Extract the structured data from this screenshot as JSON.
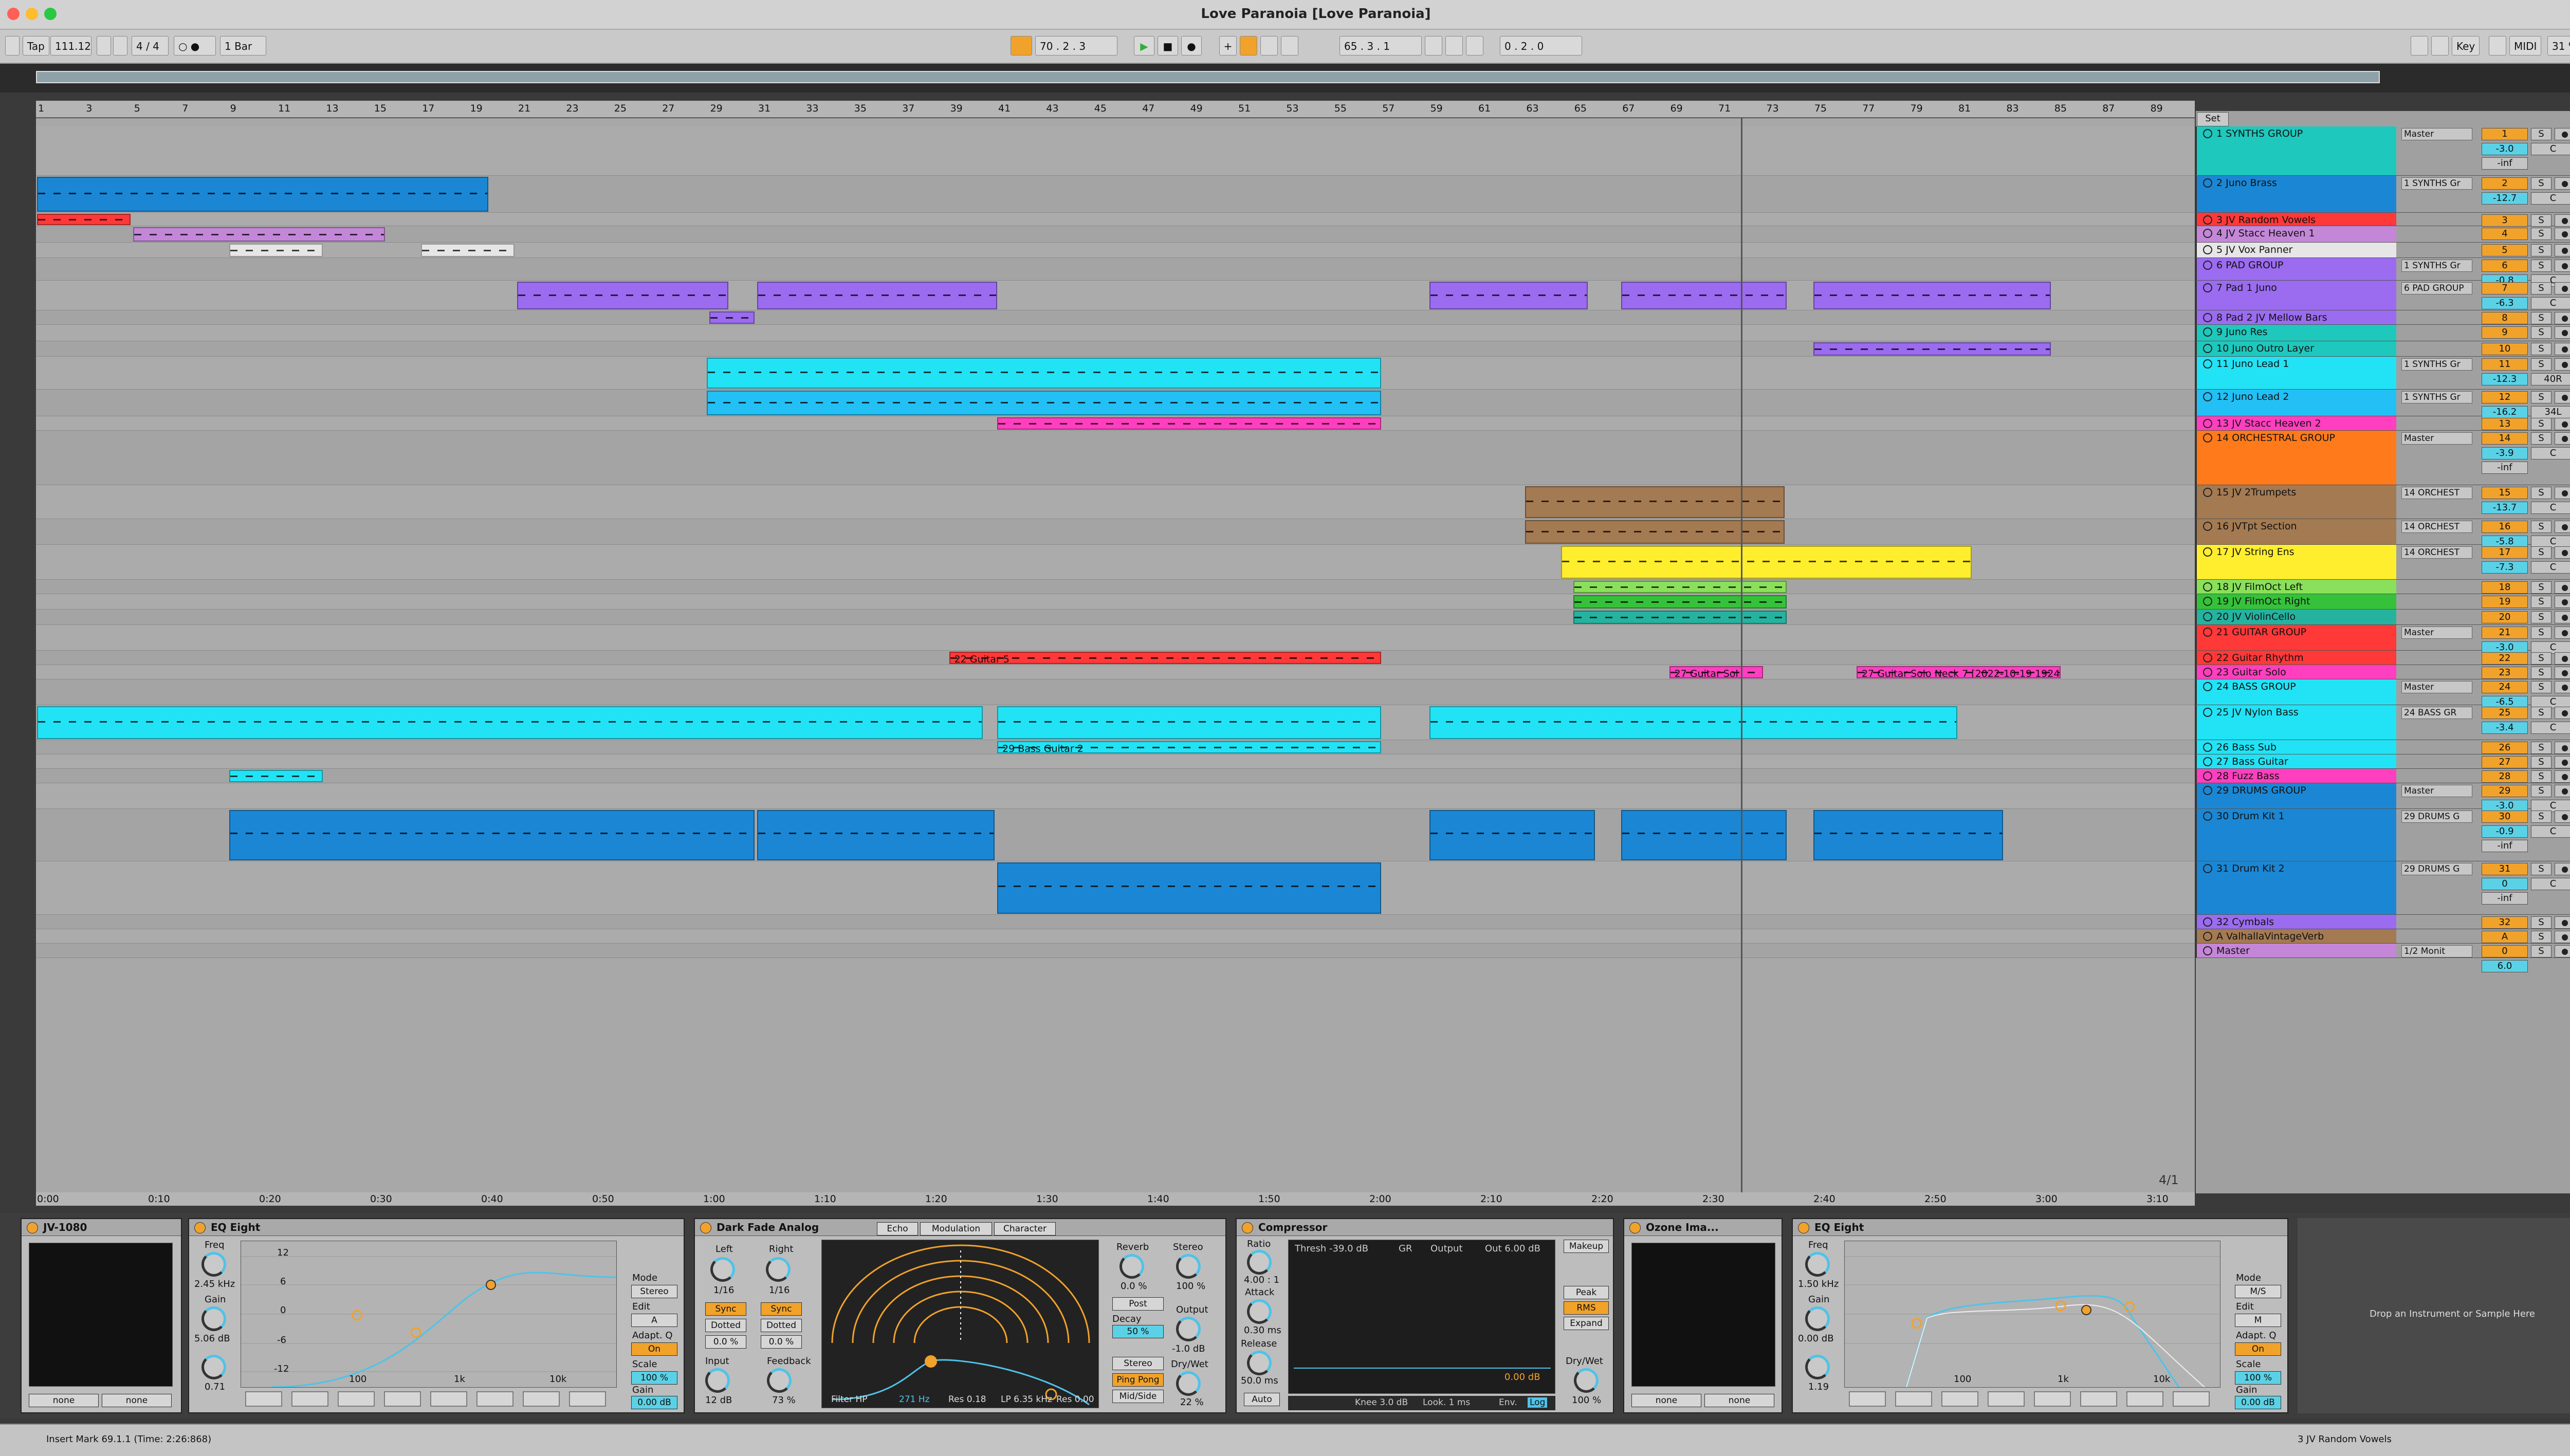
{
  "window": {
    "title": "Love Paranoia  [Love Paranoia]"
  },
  "toolbar": {
    "tap": "Tap",
    "tempo": "111.12",
    "time_signature": "4 / 4",
    "metronome": "○ ●",
    "quantize": "1 Bar",
    "arrangement_position": "70 .  2 .  3",
    "loop_start": "65 .  3 .  1",
    "loop_length": "0 .  2 .  0",
    "key_label": "Key",
    "midi_label": "MIDI",
    "cpu": "31 %"
  },
  "ruler": {
    "bars": [
      "1",
      "3",
      "5",
      "7",
      "9",
      "11",
      "13",
      "15",
      "17",
      "19",
      "21",
      "23",
      "25",
      "27",
      "29",
      "31",
      "33",
      "35",
      "37",
      "39",
      "41",
      "43",
      "45",
      "47",
      "49",
      "51",
      "53",
      "55",
      "57",
      "59",
      "61",
      "63",
      "65",
      "67",
      "69",
      "71",
      "73",
      "75",
      "77",
      "79",
      "81",
      "83",
      "85",
      "87",
      "89"
    ],
    "set_label": "Set"
  },
  "time_ruler": [
    "0:00",
    "0:10",
    "0:20",
    "0:30",
    "0:40",
    "0:50",
    "1:00",
    "1:10",
    "1:20",
    "1:30",
    "1:40",
    "1:50",
    "2:00",
    "2:10",
    "2:20",
    "2:30",
    "2:40",
    "2:50",
    "3:00",
    "3:10"
  ],
  "zoom_label": "4/1",
  "clip_labels": {
    "guitar5": "22 Guitar 5",
    "guitar_solo": "27 Guitar Sol",
    "guitar_solo_neck": "27 Guitar Solo Neck 7 [2022-10-19 192443]",
    "bass_guitar2": "29 Bass Guitar 2"
  },
  "tracks": [
    {
      "name": "1 SYNTHS GROUP",
      "color": "#1ec8bd",
      "route": "Master",
      "num": "1",
      "vol": "-3.0",
      "pan": "C",
      "extra": "-inf"
    },
    {
      "name": "2 Juno Brass",
      "color": "#1b87d4",
      "route": "1 SYNTHS Gr",
      "num": "2",
      "vol": "-12.7",
      "pan": "C"
    },
    {
      "name": "3 JV Random Vowels",
      "color": "#ff3838",
      "route": "",
      "num": "3",
      "vol": "",
      "pan": ""
    },
    {
      "name": "4 JV Stacc Heaven 1",
      "color": "#c487d8",
      "route": "",
      "num": "4",
      "vol": "",
      "pan": ""
    },
    {
      "name": "5 JV Vox Panner",
      "color": "#e6e6e6",
      "route": "",
      "num": "5",
      "vol": "",
      "pan": ""
    },
    {
      "name": "6 PAD GROUP",
      "color": "#9b6bf0",
      "route": "1 SYNTHS Gr",
      "num": "6",
      "vol": "-0.8",
      "pan": "C"
    },
    {
      "name": "7 Pad 1 Juno",
      "color": "#9b6bf0",
      "route": "6 PAD GROUP",
      "num": "7",
      "vol": "-6.3",
      "pan": "C"
    },
    {
      "name": "8 Pad 2 JV Mellow Bars",
      "color": "#9b6bf0",
      "route": "",
      "num": "8",
      "vol": "",
      "pan": ""
    },
    {
      "name": "9 Juno Res",
      "color": "#1ec8bd",
      "route": "",
      "num": "9",
      "vol": "",
      "pan": ""
    },
    {
      "name": "10 Juno Outro Layer",
      "color": "#1ec8bd",
      "route": "",
      "num": "10",
      "vol": "",
      "pan": ""
    },
    {
      "name": "11 Juno Lead 1",
      "color": "#22e3f5",
      "route": "1 SYNTHS Gr",
      "num": "11",
      "vol": "-12.3",
      "pan": "40R"
    },
    {
      "name": "12 Juno Lead 2",
      "color": "#22c0f5",
      "route": "1 SYNTHS Gr",
      "num": "12",
      "vol": "-16.2",
      "pan": "34L"
    },
    {
      "name": "13 JV Stacc Heaven 2",
      "color": "#ff3fbf",
      "route": "",
      "num": "13",
      "vol": "",
      "pan": ""
    },
    {
      "name": "14 ORCHESTRAL GROUP",
      "color": "#ff7a1a",
      "route": "Master",
      "num": "14",
      "vol": "-3.9",
      "pan": "C",
      "extra": "-inf"
    },
    {
      "name": "15 JV 2Trumpets",
      "color": "#a47a52",
      "route": "14 ORCHEST",
      "num": "15",
      "vol": "-13.7",
      "pan": "C"
    },
    {
      "name": "16 JVTpt Section",
      "color": "#a47a52",
      "route": "14 ORCHEST",
      "num": "16",
      "vol": "-5.8",
      "pan": "C"
    },
    {
      "name": "17 JV String Ens",
      "color": "#ffee2e",
      "route": "14 ORCHEST",
      "num": "17",
      "vol": "-7.3",
      "pan": "C"
    },
    {
      "name": "18 JV FilmOct Left",
      "color": "#8ae05a",
      "route": "",
      "num": "18",
      "vol": "",
      "pan": ""
    },
    {
      "name": "19 JV FilmOct Right",
      "color": "#35c23a",
      "route": "",
      "num": "19",
      "vol": "",
      "pan": ""
    },
    {
      "name": "20 JV ViolinCello",
      "color": "#25b3a0",
      "route": "",
      "num": "20",
      "vol": "",
      "pan": ""
    },
    {
      "name": "21 GUITAR GROUP",
      "color": "#ff3838",
      "route": "Master",
      "num": "21",
      "vol": "-3.0",
      "pan": "C"
    },
    {
      "name": "22 Guitar Rhythm",
      "color": "#ff3838",
      "route": "",
      "num": "22",
      "vol": "",
      "pan": ""
    },
    {
      "name": "23 Guitar Solo",
      "color": "#ff3fbf",
      "route": "",
      "num": "23",
      "vol": "",
      "pan": ""
    },
    {
      "name": "24 BASS GROUP",
      "color": "#22e3f5",
      "route": "Master",
      "num": "24",
      "vol": "-6.5",
      "pan": "C"
    },
    {
      "name": "25 JV Nylon Bass",
      "color": "#22e3f5",
      "route": "24 BASS GR",
      "num": "25",
      "vol": "-3.4",
      "pan": "C"
    },
    {
      "name": "26 Bass Sub",
      "color": "#22e3f5",
      "route": "",
      "num": "26",
      "vol": "",
      "pan": ""
    },
    {
      "name": "27 Bass Guitar",
      "color": "#22e3f5",
      "route": "",
      "num": "27",
      "vol": "",
      "pan": ""
    },
    {
      "name": "28 Fuzz Bass",
      "color": "#ff3fbf",
      "route": "",
      "num": "28",
      "vol": "",
      "pan": ""
    },
    {
      "name": "29 DRUMS GROUP",
      "color": "#1b87d4",
      "route": "Master",
      "num": "29",
      "vol": "-3.0",
      "pan": "C"
    },
    {
      "name": "30 Drum Kit 1",
      "color": "#1b87d4",
      "route": "29 DRUMS G",
      "num": "30",
      "vol": "-0.9",
      "pan": "C",
      "extra": "-inf"
    },
    {
      "name": "31 Drum Kit 2",
      "color": "#1b87d4",
      "route": "29 DRUMS G",
      "num": "31",
      "vol": "0",
      "pan": "C",
      "extra": "-inf"
    },
    {
      "name": "32 Cymbals",
      "color": "#9b6bf0",
      "route": "",
      "num": "32",
      "vol": "",
      "pan": ""
    },
    {
      "name": "A ValhallaVintageVerb",
      "color": "#a47a52",
      "route": "",
      "num": "A",
      "vol": "",
      "pan": ""
    },
    {
      "name": "Master",
      "color": "#c487d8",
      "route": "1/2 Monit",
      "num": "0",
      "vol": "6.0",
      "pan": ""
    }
  ],
  "devices": {
    "jv1080": {
      "title": "JV-1080",
      "in1": "none",
      "in2": "none"
    },
    "eq1": {
      "title": "EQ Eight",
      "freq_label": "Freq",
      "freq": "2.45 kHz",
      "gain_label": "Gain",
      "gain": "5.06 dB",
      "q": "0.71",
      "mode_label": "Mode",
      "mode": "Stereo",
      "edit_label": "Edit",
      "edit": "A",
      "adaptq_label": "Adapt. Q",
      "adaptq": "On",
      "scale_label": "Scale",
      "scale": "100 %",
      "out_gain_label": "Gain",
      "out_gain": "0.00 dB",
      "axis": [
        "12",
        "6",
        "0",
        "-6",
        "-12"
      ],
      "freq_axis": [
        "100",
        "1k",
        "10k"
      ]
    },
    "delay": {
      "title": "Dark Fade Analog",
      "tabs": [
        "Echo",
        "Modulation",
        "Character"
      ],
      "left_label": "Left",
      "right_label": "Right",
      "left_val": "1/16",
      "right_val": "1/16",
      "sync": "Sync",
      "mode": "Dotted",
      "offset": "0.0 %",
      "input_label": "Input",
      "input": "12 dB",
      "feedback_label": "Feedback",
      "feedback": "73 %",
      "reverb_label": "Reverb",
      "reverb": "0.0 %",
      "stereo_label": "Stereo",
      "stereo": "100 %",
      "post": "Post",
      "decay_label": "Decay",
      "decay": "50 %",
      "output_label": "Output",
      "output": "-1.0 dB",
      "drywet_label": "Dry/Wet",
      "drywet": "22 %",
      "stereo_btn": "Stereo",
      "pingpong": "Ping Pong",
      "midside": "Mid/Side",
      "filter_label": "Filter HP",
      "filter_hp": "271 Hz",
      "res1": "Res 0.18",
      "lp": "LP 6.35 kHz",
      "res2": "Res 0.00"
    },
    "comp": {
      "title": "Compressor",
      "ratio_label": "Ratio",
      "ratio": "4.00 : 1",
      "attack_label": "Attack",
      "attack": "0.30 ms",
      "release_label": "Release",
      "release": "50.0 ms",
      "auto": "Auto",
      "thresh": "Thresh -39.0 dB",
      "gr": "GR",
      "output_lbl": "Output",
      "out": "Out 6.00 dB",
      "makeup": "Makeup",
      "peak": "Peak",
      "rms": "RMS",
      "expand": "Expand",
      "drywet_label": "Dry/Wet",
      "drywet": "100 %",
      "knee": "Knee 3.0 dB",
      "look": "Look. 1 ms",
      "env": "Env.",
      "log": "Log",
      "gain_val": "0.00 dB"
    },
    "ozone": {
      "title": "Ozone Ima...",
      "in1": "none",
      "in2": "none"
    },
    "eq2": {
      "title": "EQ Eight",
      "freq_label": "Freq",
      "freq": "1.50 kHz",
      "gain_label": "Gain",
      "gain": "0.00 dB",
      "q": "1.19",
      "mode_label": "Mode",
      "mode": "M/S",
      "edit_label": "Edit",
      "edit": "M",
      "adaptq_label": "Adapt. Q",
      "adaptq": "On",
      "scale_label": "Scale",
      "scale": "100 %",
      "out_gain_label": "Gain",
      "out_gain": "0.00 dB",
      "freq_axis": [
        "100",
        "1k",
        "10k"
      ]
    },
    "drop_hint": "Drop an Instrument or Sample Here"
  },
  "status": {
    "text": "Insert Mark 69.1.1 (Time: 2:26:868)",
    "selected_track": "3 JV Random Vowels"
  }
}
